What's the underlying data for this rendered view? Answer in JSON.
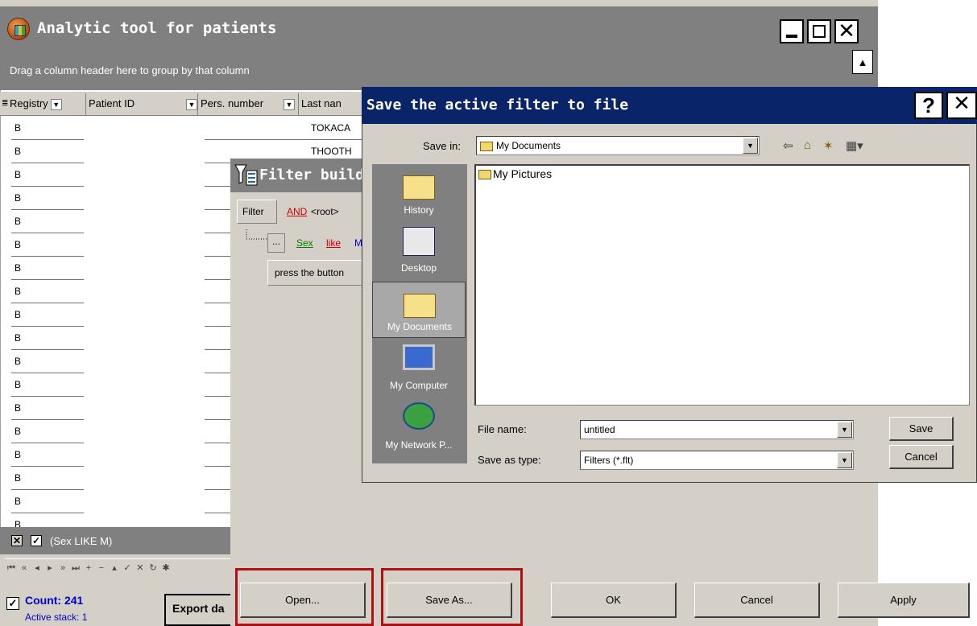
{
  "main_window": {
    "title": "Analytic tool for patients",
    "group_hint": "Drag a column header here to group by that column"
  },
  "grid": {
    "columns": [
      "Registry",
      "Patient ID",
      "Pers. number",
      "Last nan"
    ],
    "rows": [
      {
        "registry": "B",
        "last_name": "TOKACA"
      },
      {
        "registry": "B",
        "last_name": "THOOTH"
      },
      {
        "registry": "B",
        "last_name": ""
      },
      {
        "registry": "B",
        "last_name": ""
      },
      {
        "registry": "B",
        "last_name": ""
      },
      {
        "registry": "B",
        "last_name": ""
      },
      {
        "registry": "B",
        "last_name": ""
      },
      {
        "registry": "B",
        "last_name": ""
      },
      {
        "registry": "B",
        "last_name": ""
      },
      {
        "registry": "B",
        "last_name": ""
      },
      {
        "registry": "B",
        "last_name": ""
      },
      {
        "registry": "B",
        "last_name": ""
      },
      {
        "registry": "B",
        "last_name": ""
      },
      {
        "registry": "B",
        "last_name": ""
      },
      {
        "registry": "B",
        "last_name": ""
      },
      {
        "registry": "B",
        "last_name": ""
      },
      {
        "registry": "B",
        "last_name": ""
      },
      {
        "registry": "B",
        "last_name": ""
      }
    ],
    "active_filter": "(Sex LIKE M)"
  },
  "status": {
    "count": "Count: 241",
    "active_stack": "Active stack: 1",
    "export_label": "Export da"
  },
  "filter_builder": {
    "title": "Filter builde",
    "filter_btn": "Filter",
    "op": "AND",
    "root": "<root>",
    "dots": "...",
    "field": "Sex",
    "cmp": "like",
    "val": "M",
    "press_btn": "press the button",
    "buttons": {
      "open": "Open...",
      "save_as": "Save As...",
      "ok": "OK",
      "cancel": "Cancel",
      "apply": "Apply"
    }
  },
  "save_dialog": {
    "title": "Save the active filter to file",
    "help": "?",
    "save_in_label": "Save in:",
    "save_in_value": "My Documents",
    "places": [
      "History",
      "Desktop",
      "My Documents",
      "My Computer",
      "My Network P..."
    ],
    "files": [
      "My Pictures"
    ],
    "file_name_label": "File name:",
    "file_name_value": "untitled",
    "save_as_type_label": "Save as type:",
    "save_as_type_value": "Filters (*.flt)",
    "save_btn": "Save",
    "cancel_btn": "Cancel"
  },
  "colors": {
    "titlebar": "#808080",
    "dialog_title": "#0a246a",
    "highlight": "#b01010",
    "link_red": "#cc0000",
    "link_green": "#008000",
    "link_blue": "#0000cc",
    "count_blue": "#0000cc"
  }
}
